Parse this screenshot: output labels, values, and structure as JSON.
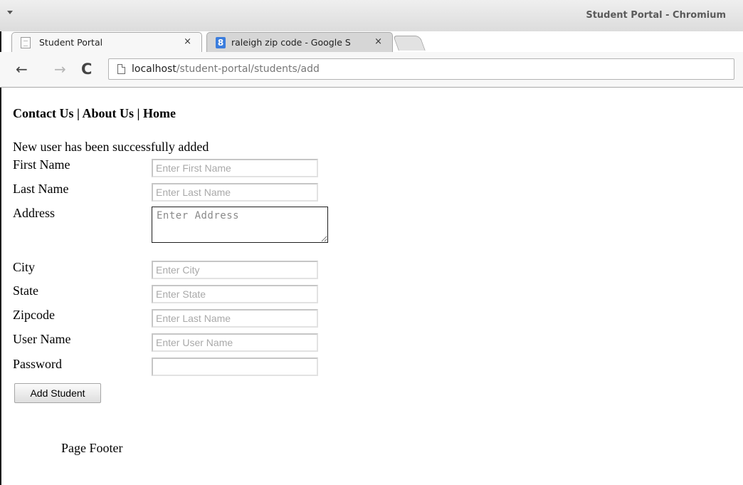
{
  "window": {
    "title": "Student Portal - Chromium"
  },
  "tabs": [
    {
      "label": "Student Portal",
      "close": "×",
      "icon": "page-icon"
    },
    {
      "label": "raleigh zip code - Google S",
      "close": "×",
      "icon": "google-icon",
      "favicon_text": "8"
    }
  ],
  "toolbar": {
    "back": "←",
    "forward": "→",
    "reload": "C",
    "url_host": "localhost",
    "url_path": "/student-portal/students/add"
  },
  "nav": {
    "contact": "Contact Us",
    "about": "About Us",
    "home": "Home",
    "separator": " | "
  },
  "message": "New user has been successfully added",
  "form": {
    "first_name": {
      "label": "First Name",
      "placeholder": "Enter First Name",
      "value": ""
    },
    "last_name": {
      "label": "Last Name",
      "placeholder": "Enter Last Name",
      "value": ""
    },
    "address": {
      "label": "Address",
      "placeholder": "Enter Address",
      "value": ""
    },
    "city": {
      "label": "City",
      "placeholder": "Enter City",
      "value": ""
    },
    "state": {
      "label": "State",
      "placeholder": "Enter State",
      "value": ""
    },
    "zipcode": {
      "label": "Zipcode",
      "placeholder": "Enter Last Name",
      "value": ""
    },
    "username": {
      "label": "User Name",
      "placeholder": "Enter User Name",
      "value": ""
    },
    "password": {
      "label": "Password",
      "placeholder": "",
      "value": ""
    },
    "submit_label": "Add Student"
  },
  "footer": "Page Footer"
}
